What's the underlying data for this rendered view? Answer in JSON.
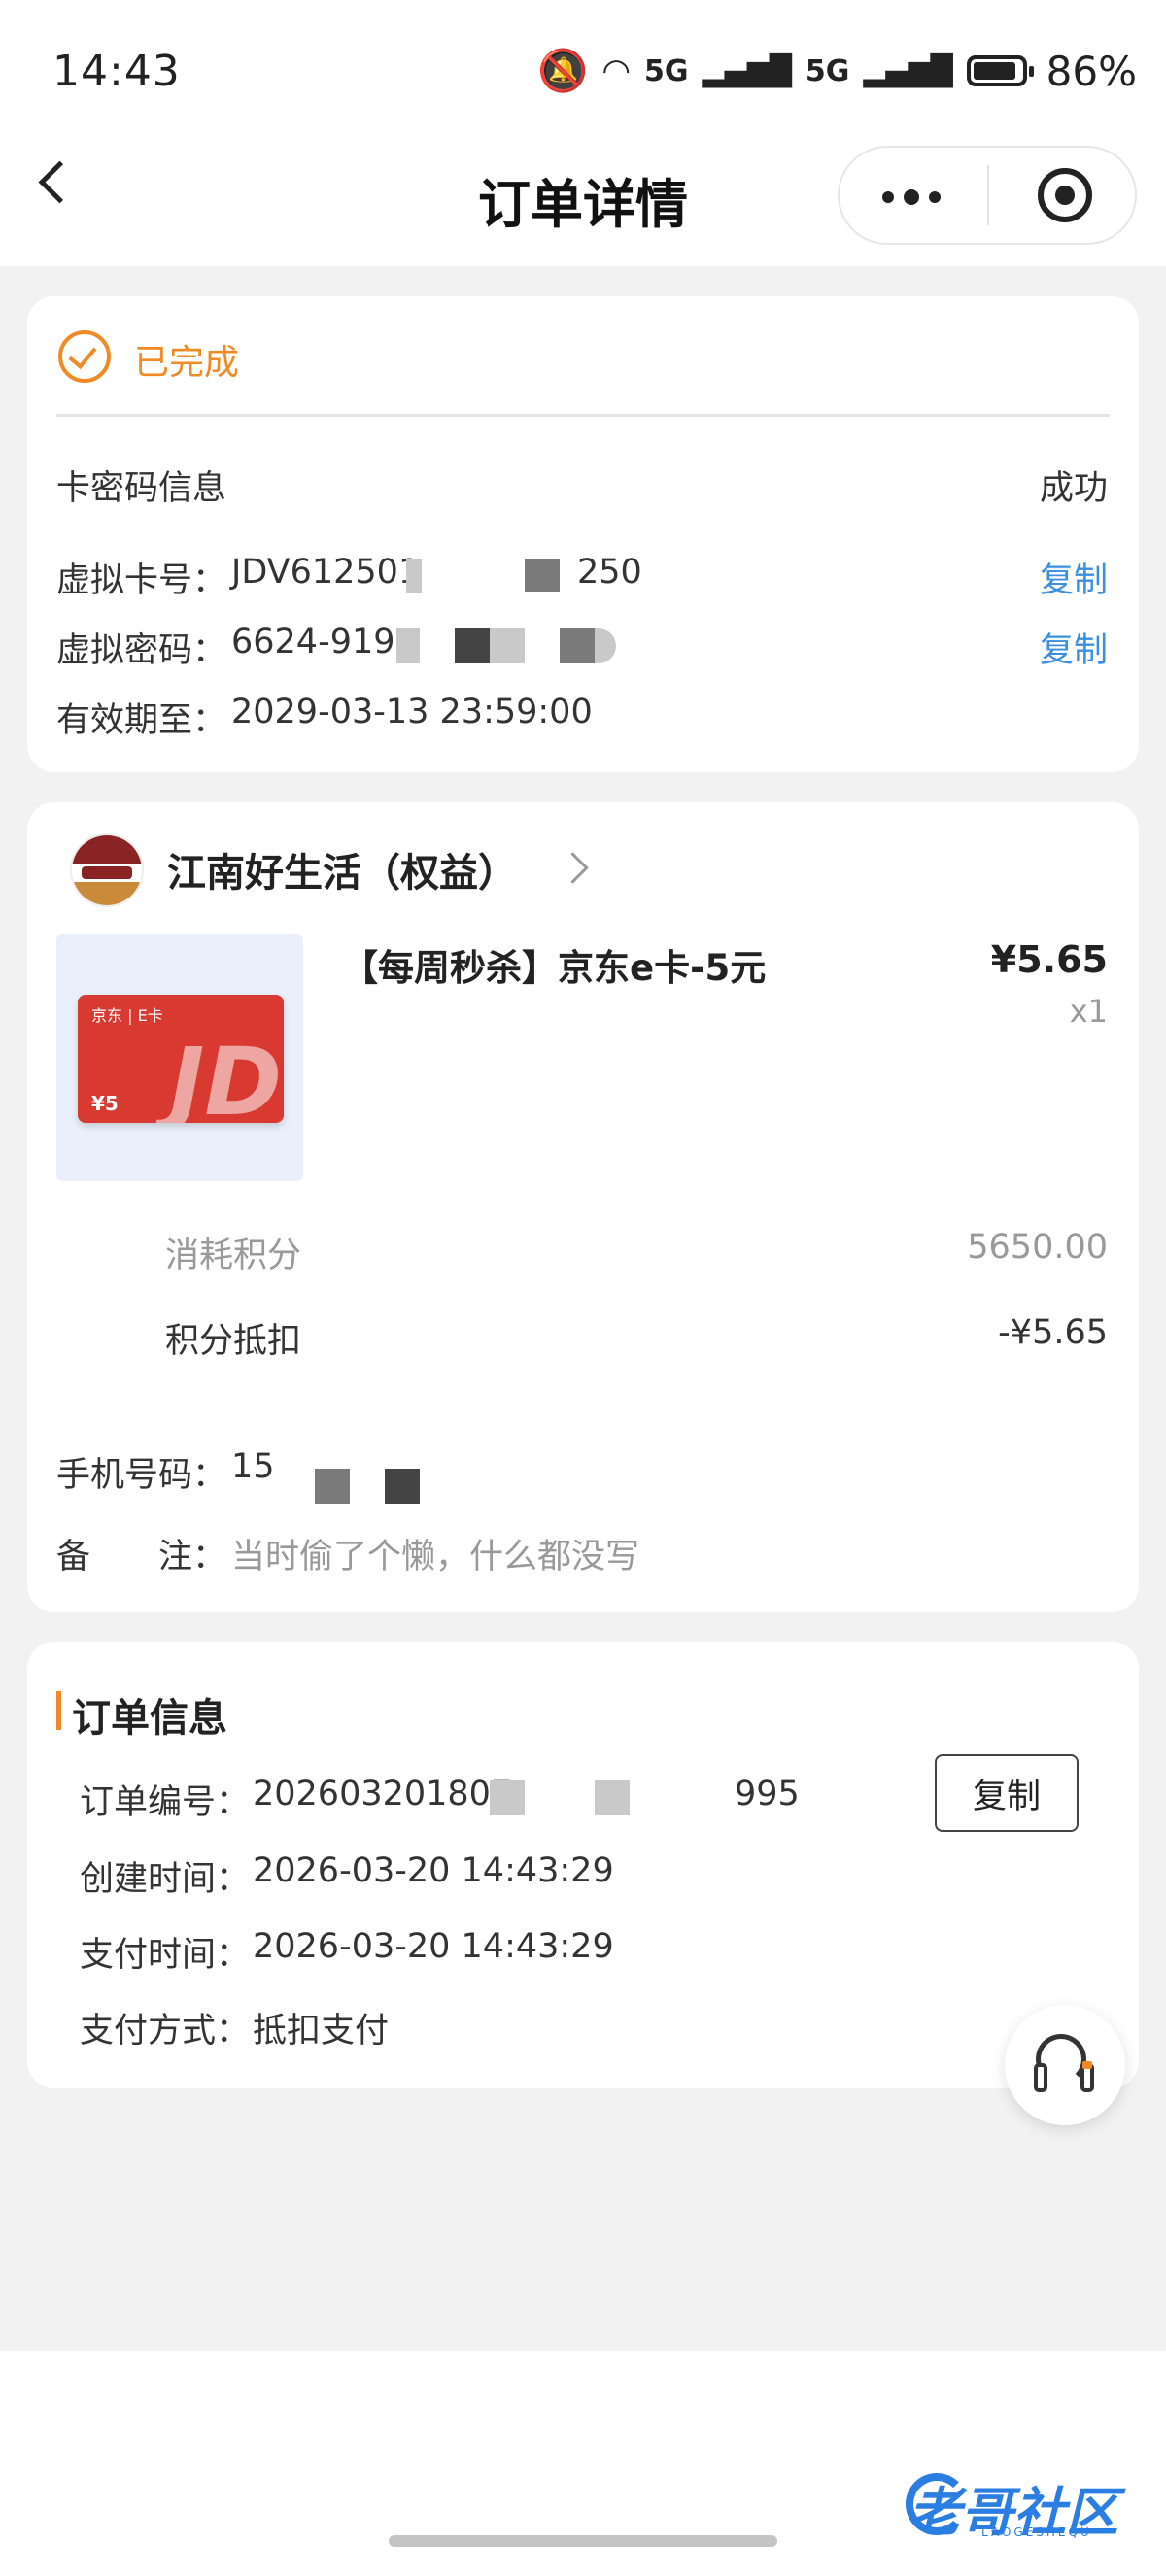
{
  "status_bar": {
    "time": "14:43",
    "network_a": "5G",
    "network_b": "5G",
    "battery": "86%"
  },
  "nav": {
    "title": "订单详情"
  },
  "card_info": {
    "status": "已完成",
    "section_label": "卡密码信息",
    "section_status": "成功",
    "card_no_label": "虚拟卡号：",
    "card_no_start": "JDV612501",
    "card_no_end": "250",
    "password_label": "虚拟密码：",
    "password_start": "6624-919",
    "expiry_label": "有效期至：",
    "expiry_value": "2029-03-13 23:59:00",
    "copy_label": "复制"
  },
  "store": {
    "name": "江南好生活（权益）"
  },
  "product": {
    "name": "【每周秒杀】京东e卡-5元",
    "price": "¥5.65",
    "qty": "x1",
    "thumb_brand": "京东 | E卡",
    "thumb_value": "¥5",
    "thumb_mark": "JD"
  },
  "points": {
    "consume_label": "消耗积分",
    "consume_value": "5650.00",
    "deduct_label": "积分抵扣",
    "deduct_value": "-¥5.65"
  },
  "contact": {
    "phone_label": "手机号码：",
    "phone_start": "15",
    "remark_label": "备　　注：",
    "remark_value": "当时偷了个懒，什么都没写"
  },
  "order_info": {
    "title": "订单信息",
    "order_no_label": "订单编号：",
    "order_no_start": "202603201807",
    "order_no_end": "995",
    "copy_button": "复制",
    "created_label": "创建时间：",
    "created_value": "2026-03-20 14:43:29",
    "paid_label": "支付时间：",
    "paid_value": "2026-03-20 14:43:29",
    "method_label": "支付方式：",
    "method_value": "抵扣支付"
  },
  "watermark": {
    "text": "老哥社区",
    "sub": "LAOGESHEQU"
  },
  "colors": {
    "accent": "#f08a24",
    "link": "#3a8fe0",
    "background": "#f2f2f3"
  }
}
